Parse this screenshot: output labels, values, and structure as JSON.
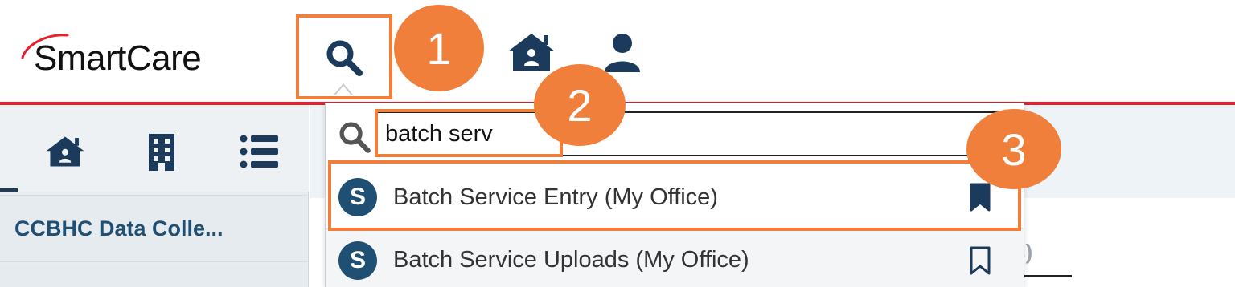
{
  "header": {
    "logo_text": "SmartCare",
    "search_icon": "search-icon",
    "home_icon": "home-icon",
    "user_icon": "user-icon"
  },
  "sidebar": {
    "icons": [
      "home-icon",
      "building-icon",
      "list-icon"
    ],
    "items": [
      {
        "label": "CCBHC Data Colle..."
      }
    ]
  },
  "main": {
    "partial_tab_text": "s)"
  },
  "search": {
    "value": "batch serv",
    "placeholder": "",
    "results": [
      {
        "avatar": "S",
        "label": "Batch Service Entry (My Office)",
        "bookmarked": true
      },
      {
        "avatar": "S",
        "label": "Batch Service Uploads (My Office)",
        "bookmarked": false
      }
    ]
  },
  "callouts": [
    "1",
    "2",
    "3"
  ],
  "colors": {
    "accent_red": "#e8202a",
    "callout_orange": "#f07f3c",
    "navy": "#1f4f72",
    "icon_navy": "#1b3a5c"
  }
}
